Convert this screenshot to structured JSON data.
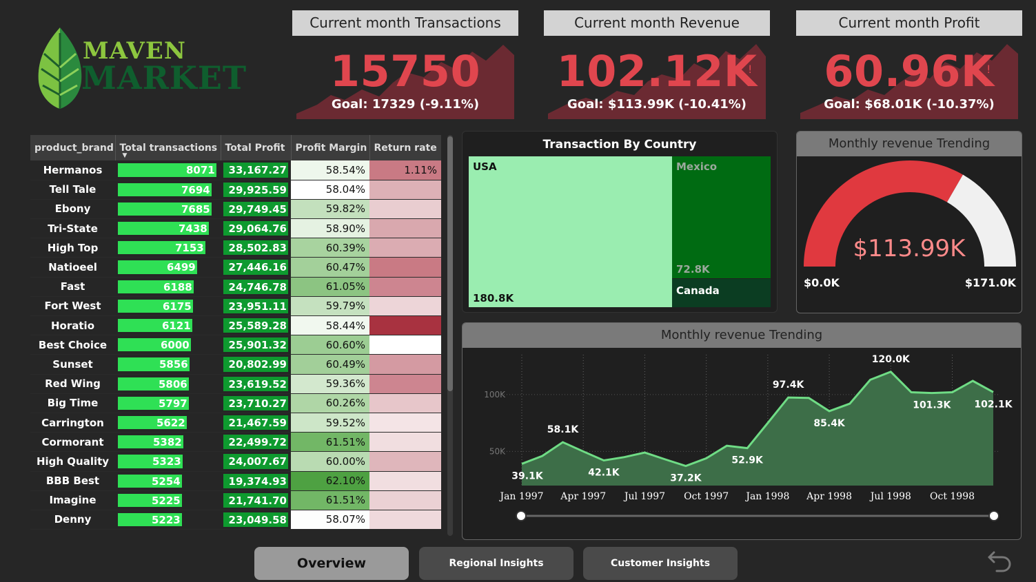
{
  "logo": {
    "line1": "MAVEN",
    "line2": "MARKET"
  },
  "kpis": [
    {
      "title": "Current month Transactions",
      "value": "15750",
      "goal_label": "Goal:",
      "goal_value": "17329",
      "goal_change": "(-9.11%)",
      "alert": "!"
    },
    {
      "title": "Current month Revenue",
      "value": "102.12K",
      "goal_label": "Goal:",
      "goal_value": "$113.99K",
      "goal_change": "(-10.41%)",
      "alert": "!"
    },
    {
      "title": "Current month Profit",
      "value": "60.96K",
      "goal_label": "Goal:",
      "goal_value": "$68.01K",
      "goal_change": "(-10.37%)",
      "alert": "!"
    }
  ],
  "table": {
    "columns": [
      "product_brand",
      "Total transactions",
      "Total Profit",
      "Profit Margin",
      "Return rate"
    ],
    "rows": [
      {
        "brand": "Hermanos",
        "transactions": 8071,
        "transactions_label": "8071",
        "profit": "33,167.27",
        "margin": "58.54%",
        "return_rate": "1.11%",
        "margin_color": "#eef7ec",
        "return_color": "#c97a84"
      },
      {
        "brand": "Tell Tale",
        "transactions": 7694,
        "transactions_label": "7694",
        "profit": "29,925.59",
        "margin": "58.04%",
        "return_color": "#ddb1b6",
        "margin_color": "#ffffff"
      },
      {
        "brand": "Ebony",
        "transactions": 7685,
        "transactions_label": "7685",
        "profit": "29,749.45",
        "margin": "59.82%",
        "return_color": "#e9cdd0",
        "margin_color": "#c3e0bd"
      },
      {
        "brand": "Tri-State",
        "transactions": 7438,
        "transactions_label": "7438",
        "profit": "29,064.76",
        "margin": "58.90%",
        "return_color": "#d9a8ae",
        "margin_color": "#e5f2e2"
      },
      {
        "brand": "High Top",
        "transactions": 7153,
        "transactions_label": "7153",
        "profit": "28,502.83",
        "margin": "60.39%",
        "return_color": "#dbacb2",
        "margin_color": "#a8d39f"
      },
      {
        "brand": "Natioeel",
        "transactions": 6499,
        "transactions_label": "6499",
        "profit": "27,446.16",
        "margin": "60.47%",
        "return_color": "#c97a84",
        "margin_color": "#a3d09a"
      },
      {
        "brand": "Fast",
        "transactions": 6188,
        "transactions_label": "6188",
        "profit": "24,746.78",
        "margin": "61.05%",
        "return_color": "#cd8590",
        "margin_color": "#8cc482"
      },
      {
        "brand": "Fort West",
        "transactions": 6175,
        "transactions_label": "6175",
        "profit": "23,951.11",
        "margin": "59.79%",
        "return_color": "#edd5d8",
        "margin_color": "#c5e1bf"
      },
      {
        "brand": "Horatio",
        "transactions": 6121,
        "transactions_label": "6121",
        "profit": "25,589.28",
        "margin": "58.44%",
        "return_color": "#a83240",
        "margin_color": "#f1f8ef"
      },
      {
        "brand": "Best Choice",
        "transactions": 6000,
        "transactions_label": "6000",
        "profit": "25,901.32",
        "margin": "60.60%",
        "return_color": "#ffffff",
        "margin_color": "#9ccd93"
      },
      {
        "brand": "Sunset",
        "transactions": 5856,
        "transactions_label": "5856",
        "profit": "20,802.99",
        "margin": "60.49%",
        "return_color": "#d49aa2",
        "margin_color": "#a2cf99"
      },
      {
        "brand": "Red Wing",
        "transactions": 5806,
        "transactions_label": "5806",
        "profit": "23,619.52",
        "margin": "59.36%",
        "return_color": "#cd8590",
        "margin_color": "#d3e8ce"
      },
      {
        "brand": "Big Time",
        "transactions": 5797,
        "transactions_label": "5797",
        "profit": "23,710.27",
        "margin": "60.26%",
        "return_color": "#e7c6ca",
        "margin_color": "#afd6a6"
      },
      {
        "brand": "Carrington",
        "transactions": 5622,
        "transactions_label": "5622",
        "profit": "21,467.59",
        "margin": "59.52%",
        "return_color": "#f4e4e6",
        "margin_color": "#cde6c8"
      },
      {
        "brand": "Cormorant",
        "transactions": 5382,
        "transactions_label": "5382",
        "profit": "22,499.72",
        "margin": "61.51%",
        "return_color": "#f1dee0",
        "margin_color": "#72b766"
      },
      {
        "brand": "High Quality",
        "transactions": 5323,
        "transactions_label": "5323",
        "profit": "24,007.67",
        "margin": "60.00%",
        "return_color": "#dfb6bb",
        "margin_color": "#b9dbb2"
      },
      {
        "brand": "BBB Best",
        "transactions": 5254,
        "transactions_label": "5254",
        "profit": "19,374.93",
        "margin": "62.10%",
        "return_color": "#f1dee0",
        "margin_color": "#4ea142"
      },
      {
        "brand": "Imagine",
        "transactions": 5225,
        "transactions_label": "5225",
        "profit": "21,741.70",
        "margin": "61.51%",
        "return_color": "#ebd1d4",
        "margin_color": "#72b766"
      },
      {
        "brand": "Denny",
        "transactions": 5223,
        "transactions_label": "5223",
        "profit": "23,049.58",
        "margin": "58.07%",
        "return_color": "#efd9dc",
        "margin_color": "#fdfefd"
      }
    ],
    "max_transactions": 8071
  },
  "treemap": {
    "title": "Transaction By Country",
    "items": [
      {
        "label": "USA",
        "value": "180.8K",
        "color": "#9aedb0"
      },
      {
        "label": "Mexico",
        "value": "72.8K",
        "color": "#006b12"
      },
      {
        "label": "Canada",
        "value": "",
        "color": "#0b3d22"
      }
    ]
  },
  "gauge": {
    "title": "Monthly revenue Trending",
    "value_label": "$113.99K",
    "min_label": "$0.0K",
    "max_label": "$171.0K",
    "value": 113.99,
    "max": 171.0,
    "fill_color": "#e0393f",
    "track_color": "#f0f0f0"
  },
  "chart_data": {
    "type": "area",
    "title": "Monthly revenue Trending",
    "x": [
      "Jan 1997",
      "Feb 1997",
      "Mar 1997",
      "Apr 1997",
      "May 1997",
      "Jun 1997",
      "Jul 1997",
      "Aug 1997",
      "Sep 1997",
      "Oct 1997",
      "Nov 1997",
      "Dec 1997",
      "Jan 1998",
      "Feb 1998",
      "Mar 1998",
      "Apr 1998",
      "May 1998",
      "Jun 1998",
      "Jul 1998",
      "Aug 1998",
      "Sep 1998",
      "Oct 1998",
      "Nov 1998",
      "Dec 1998"
    ],
    "x_tick_labels": [
      "Jan 1997",
      "Apr 1997",
      "Jul 1997",
      "Oct 1997",
      "Jan 1998",
      "Apr 1998",
      "Jul 1998",
      "Oct 1998"
    ],
    "values": [
      39.1,
      46,
      58.1,
      50,
      42.1,
      45,
      49,
      43,
      37.2,
      44,
      55,
      52.9,
      75,
      97.4,
      97,
      85.4,
      92,
      113,
      120.0,
      102,
      101.3,
      102,
      112,
      102.1
    ],
    "data_labels": {
      "0": "39.1K",
      "2": "58.1K",
      "4": "42.1K",
      "8": "37.2K",
      "11": "52.9K",
      "13": "97.4K",
      "15": "85.4K",
      "18": "120.0K",
      "20": "101.3K",
      "23": "102.1K"
    },
    "y_ticks": [
      {
        "value": 50,
        "label": "50K"
      },
      {
        "value": 100,
        "label": "100K"
      }
    ],
    "ylim": [
      20,
      135
    ],
    "grid": true,
    "color": "#6fdc85",
    "fill": "#3d6e48"
  },
  "nav": {
    "overview": "Overview",
    "regional": "Regional Insights",
    "customer": "Customer Insights"
  }
}
